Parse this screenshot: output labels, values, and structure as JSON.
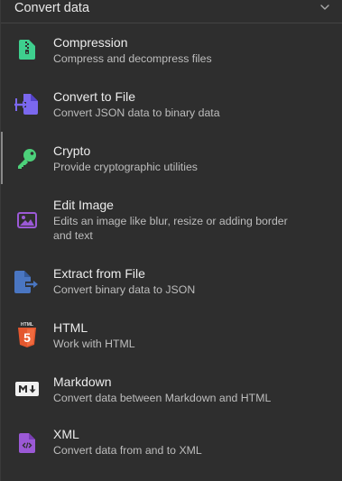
{
  "section": {
    "title": "Convert data",
    "toggle_icon": "chevron-down-icon"
  },
  "items": [
    {
      "title": "Compression",
      "description": "Compress and decompress files",
      "icon": "file-archive-icon",
      "color": "#3ecf8e"
    },
    {
      "title": "Convert to File",
      "description": "Convert JSON data to binary data",
      "icon": "file-import-icon",
      "color": "#7b68ee"
    },
    {
      "title": "Crypto",
      "description": "Provide cryptographic utilities",
      "icon": "key-icon",
      "color": "#4cd17a"
    },
    {
      "title": "Edit Image",
      "description": "Edits an image like blur, resize or adding border and text",
      "icon": "image-icon",
      "color": "#9b59d6"
    },
    {
      "title": "Extract from File",
      "description": "Convert binary data to JSON",
      "icon": "file-export-icon",
      "color": "#4a76c2"
    },
    {
      "title": "HTML",
      "description": "Work with HTML",
      "icon": "html5-icon",
      "color": "#e4572e"
    },
    {
      "title": "Markdown",
      "description": "Convert data between Markdown and HTML",
      "icon": "markdown-icon",
      "color": "#f0f0f0"
    },
    {
      "title": "XML",
      "description": "Convert data from and to XML",
      "icon": "file-code-icon",
      "color": "#9b59d6"
    }
  ],
  "html_badge": {
    "top": "HTML",
    "numeral": "5"
  },
  "selected_index": 2
}
